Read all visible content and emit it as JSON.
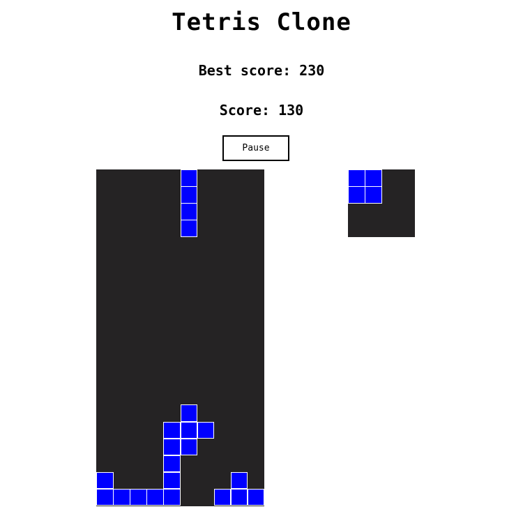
{
  "title": "Tetris Clone",
  "best_score": "Best score: 230",
  "score": "Score: 130",
  "pause_label": "Pause",
  "colors": {
    "block": "#0000ff",
    "board_background": "#252324",
    "cell_border": "#ffffff"
  },
  "board": {
    "columns": 10,
    "rows": 20,
    "active_piece": {
      "shape": "I",
      "cells": [
        [
          5,
          0
        ],
        [
          5,
          1
        ],
        [
          5,
          2
        ],
        [
          5,
          3
        ]
      ]
    },
    "locked_cells": [
      [
        5,
        14
      ],
      [
        4,
        15
      ],
      [
        5,
        15
      ],
      [
        6,
        15
      ],
      [
        4,
        16
      ],
      [
        5,
        16
      ],
      [
        4,
        17
      ],
      [
        0,
        18
      ],
      [
        4,
        18
      ],
      [
        8,
        18
      ],
      [
        0,
        19
      ],
      [
        1,
        19
      ],
      [
        2,
        19
      ],
      [
        3,
        19
      ],
      [
        4,
        19
      ],
      [
        7,
        19
      ],
      [
        8,
        19
      ],
      [
        9,
        19
      ]
    ]
  },
  "next_piece": {
    "columns": 4,
    "rows": 4,
    "shape": "O",
    "cells": [
      [
        0,
        0
      ],
      [
        1,
        0
      ],
      [
        0,
        1
      ],
      [
        1,
        1
      ]
    ]
  }
}
